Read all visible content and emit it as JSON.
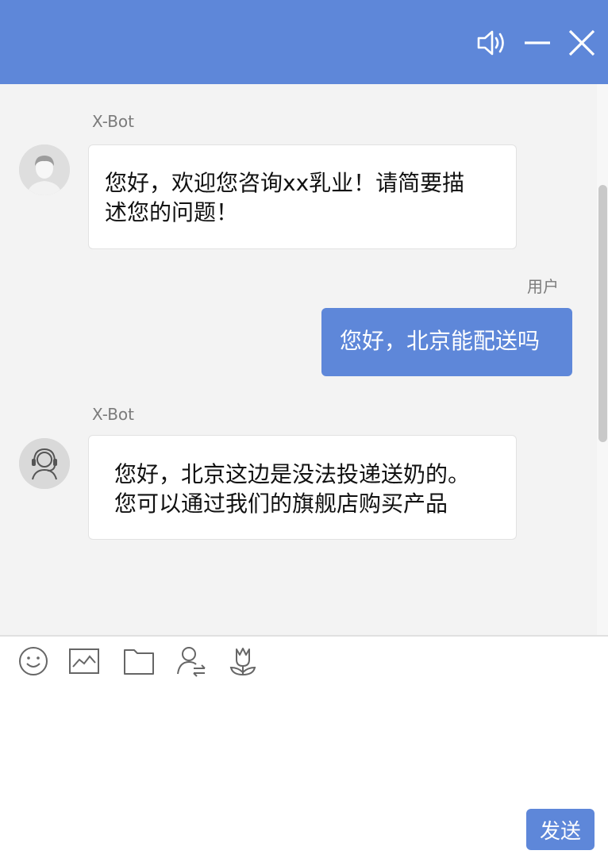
{
  "header": {
    "icons": [
      "speaker-icon",
      "minimize-icon",
      "close-icon"
    ],
    "background": "#5e87d9"
  },
  "messages": [
    {
      "sender": "X-Bot",
      "role": "bot",
      "avatar": "user-avatar-icon",
      "lines": [
        "您好，欢迎您咨询xx乳业！请简要描",
        "述您的问题！"
      ]
    },
    {
      "sender": "用户",
      "role": "user",
      "lines": [
        "您好，北京能配送吗"
      ]
    },
    {
      "sender": "X-Bot",
      "role": "bot",
      "avatar": "agent-headset-icon",
      "lines": [
        "您好，北京这边是没法投递送奶的。",
        "您可以通过我们的旗舰店购买产品"
      ]
    }
  ],
  "toolbar": {
    "icons": [
      "emoji-icon",
      "image-icon",
      "folder-icon",
      "transfer-agent-icon",
      "flower-icon"
    ]
  },
  "input": {
    "value": "",
    "placeholder": ""
  },
  "send_label": "发送",
  "colors": {
    "accent": "#5e87d9",
    "chat_bg": "#f3f3f3",
    "bubble_bot": "#ffffff"
  }
}
